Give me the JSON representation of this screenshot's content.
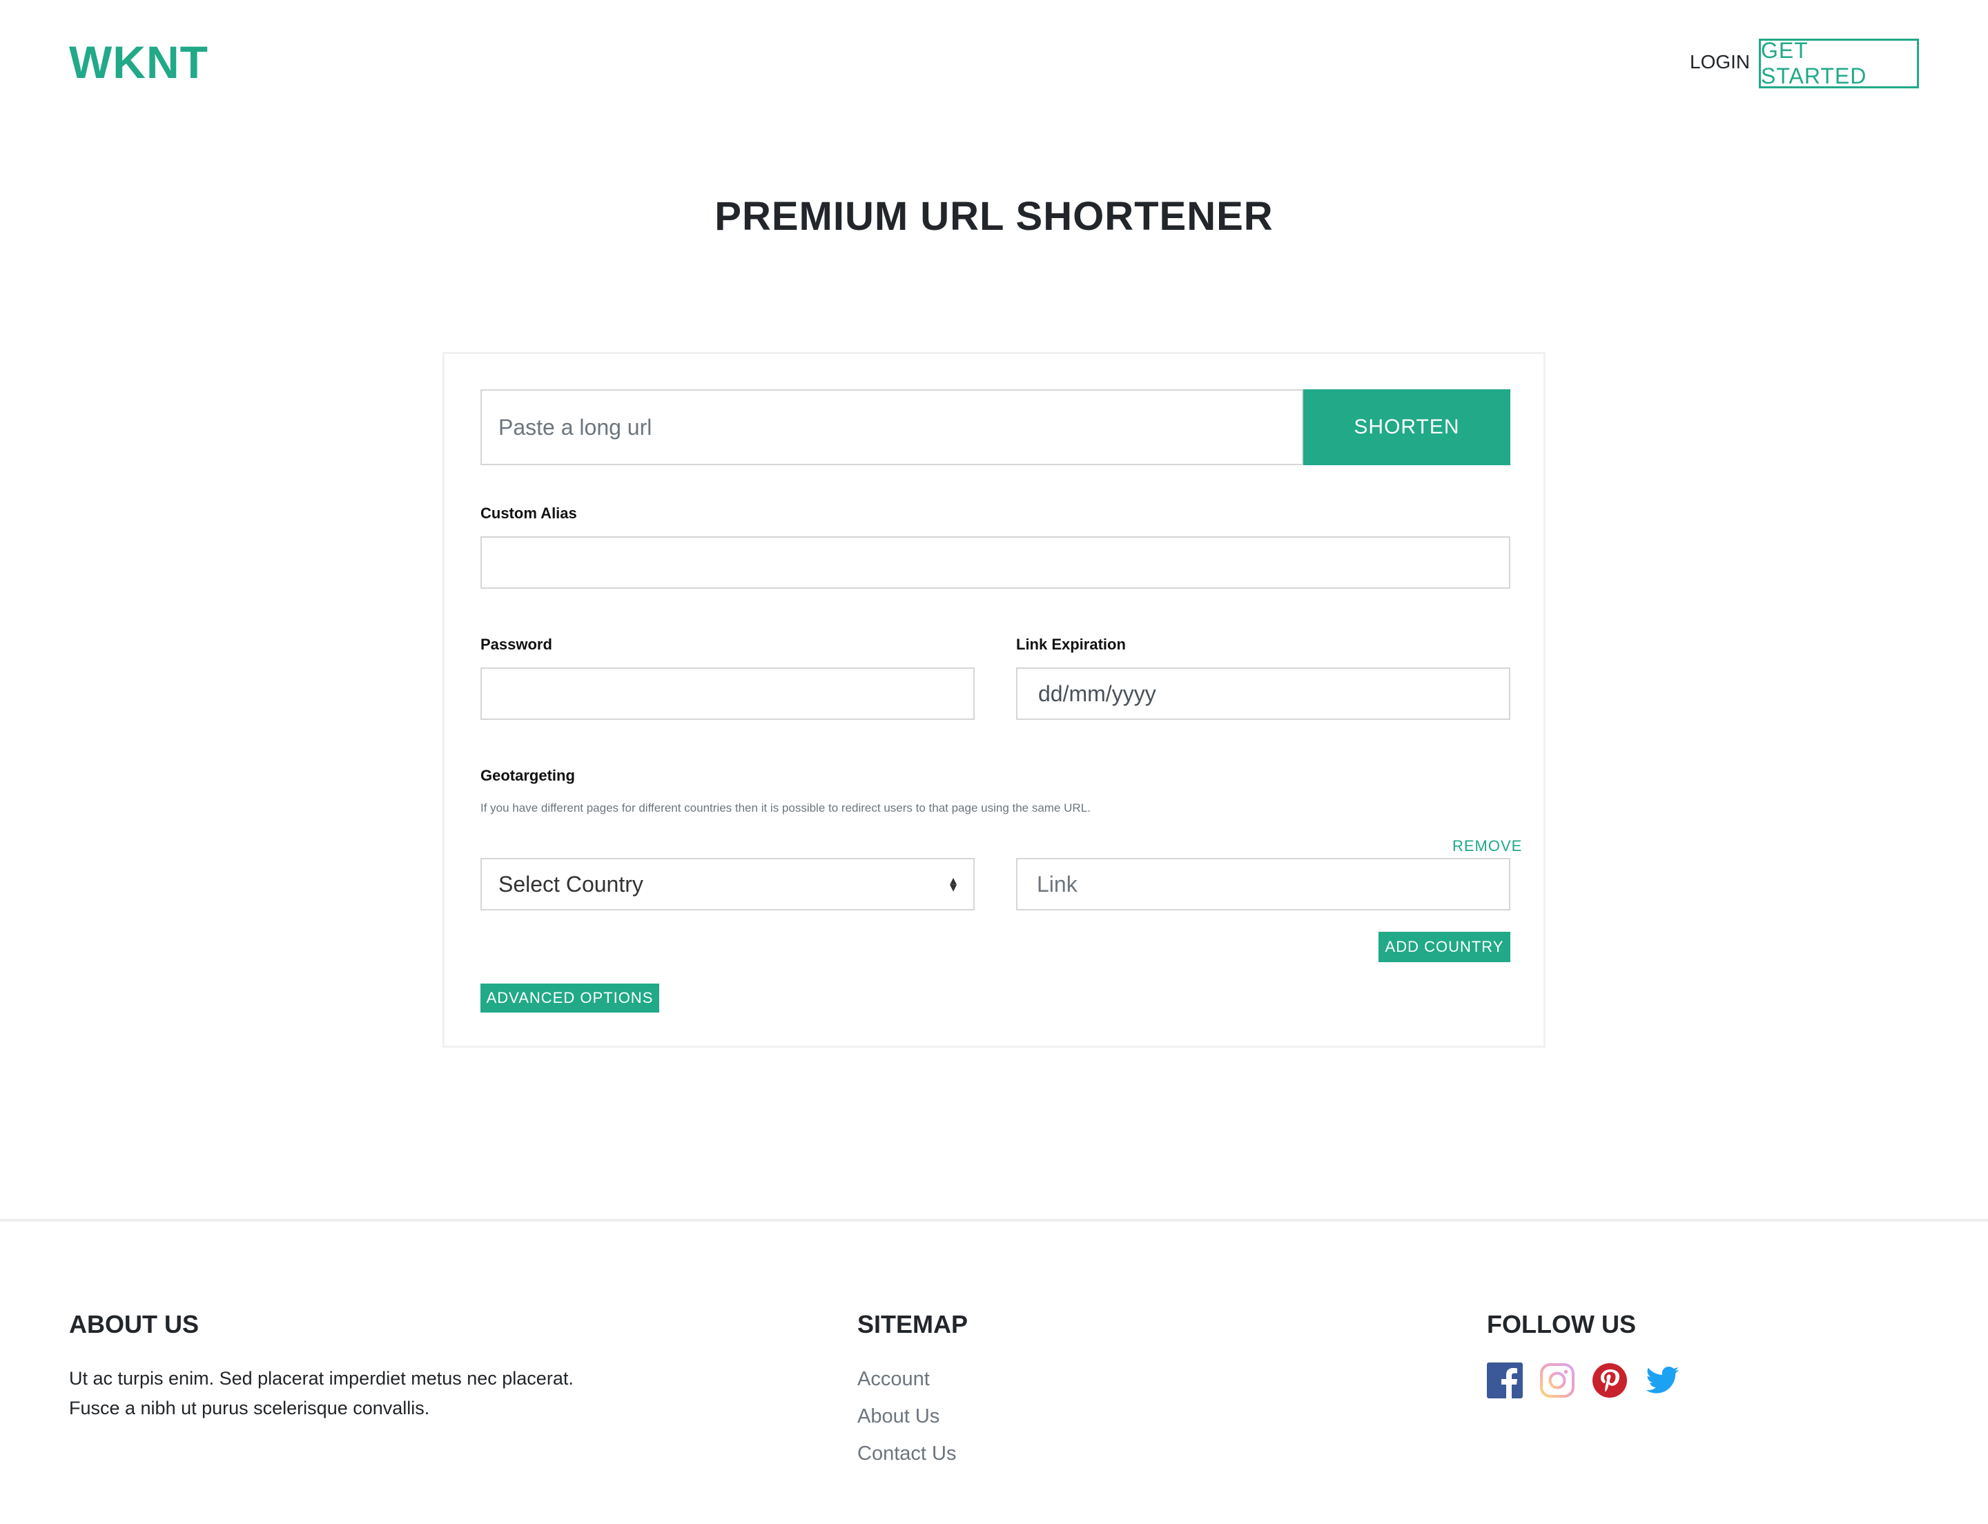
{
  "header": {
    "logo": "WKNT",
    "login_label": "LOGIN",
    "get_started_label": "GET STARTED"
  },
  "hero": {
    "title": "PREMIUM URL SHORTENER"
  },
  "form": {
    "url_placeholder": "Paste a long url",
    "shorten_label": "SHORTEN",
    "custom_alias_label": "Custom Alias",
    "custom_alias_value": "",
    "password_label": "Password",
    "password_value": "",
    "expiration_label": "Link Expiration",
    "expiration_placeholder": "dd/mm/yyyy",
    "geotargeting_label": "Geotargeting",
    "geotargeting_help": "If you have different pages for different countries then it is possible to redirect users to that page using the same URL.",
    "remove_label": "REMOVE",
    "country_select_value": "Select Country",
    "link_placeholder": "Link",
    "add_country_label": "ADD COUNTRY",
    "advanced_options_label": "ADVANCED OPTIONS"
  },
  "footer": {
    "about_title": "ABOUT US",
    "about_text_line1": "Ut ac turpis enim. Sed placerat imperdiet metus nec placerat.",
    "about_text_line2": "Fusce a nibh ut purus scelerisque convallis.",
    "sitemap_title": "SITEMAP",
    "sitemap_links": [
      "Account",
      "About Us",
      "Contact Us"
    ],
    "follow_title": "FOLLOW US",
    "social_icons": [
      "facebook-icon",
      "instagram-icon",
      "pinterest-icon",
      "twitter-icon"
    ]
  },
  "colors": {
    "accent": "#21a988",
    "facebook": "#3b5998",
    "instagram": "#e1306c",
    "pinterest": "#c8232c",
    "twitter": "#1da1f2"
  }
}
